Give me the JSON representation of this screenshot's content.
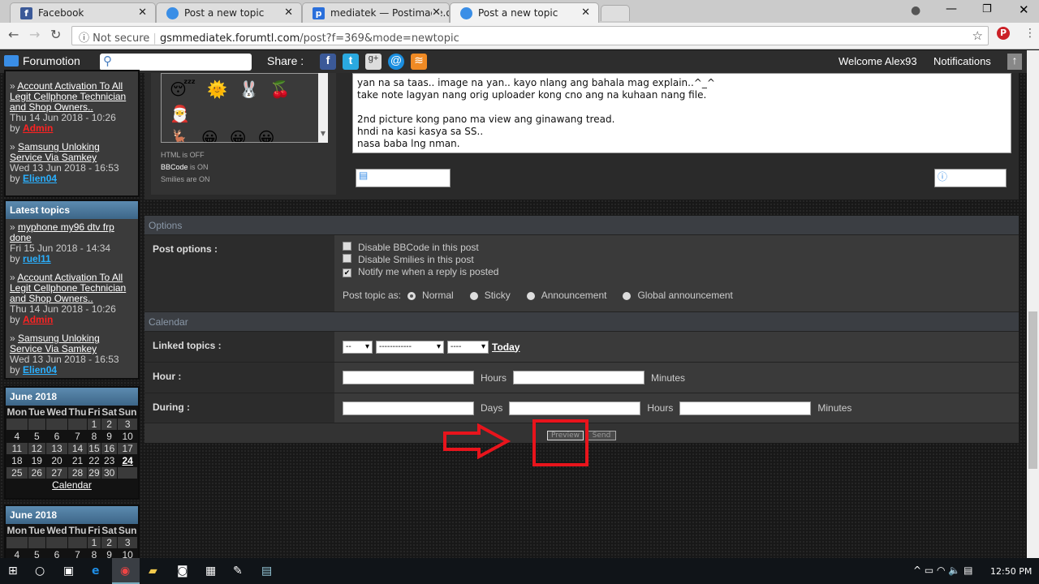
{
  "browser": {
    "tabs": [
      {
        "label": "Facebook",
        "icon": "facebook-icon",
        "color": "#3b5998"
      },
      {
        "label": "Post a new topic",
        "icon": "forumotion-icon",
        "color": "#3a8ee6"
      },
      {
        "label": "mediatek — Postimage.o",
        "icon": "postimage-icon",
        "color": "#2a6fdb"
      },
      {
        "label": "Post a new topic",
        "icon": "forumotion-icon",
        "color": "#3a8ee6"
      }
    ],
    "not_secure": "Not secure",
    "url_host": "gsmmediatek.forumtl.com",
    "url_path": "/post?f=369&mode=newtopic"
  },
  "topbar": {
    "brand": "Forumotion",
    "share_label": "Share :",
    "welcome": "Welcome Alex93",
    "notifications": "Notifications"
  },
  "sidebar": {
    "recent_items": [
      {
        "title": "Account Activation To All Legit Cellphone Technician and Shop Owners..",
        "date": "Thu 14 Jun 2018 - 10:26",
        "by": "by",
        "author": "Admin",
        "author_color": "#ff2222"
      },
      {
        "title": "Samsung Unloking Service Via Samkey",
        "date": "Wed 13 Jun 2018 - 16:53",
        "by": "by",
        "author": "Elien04",
        "author_color": "#2ab0ff"
      }
    ],
    "latest_title": "Latest topics",
    "latest_items": [
      {
        "title": "myphone my96 dtv frp done",
        "date": "Fri 15 Jun 2018 - 14:34",
        "by": "by",
        "author": "ruel11",
        "author_color": "#2ab0ff"
      },
      {
        "title": "Account Activation To All Legit Cellphone Technician and Shop Owners..",
        "date": "Thu 14 Jun 2018 - 10:26",
        "by": "by",
        "author": "Admin",
        "author_color": "#ff2222"
      },
      {
        "title": "Samsung Unloking Service Via Samkey",
        "date": "Wed 13 Jun 2018 - 16:53",
        "by": "by",
        "author": "Elien04",
        "author_color": "#2ab0ff"
      }
    ],
    "calendar": {
      "title": "June 2018",
      "days": [
        "Mon",
        "Tue",
        "Wed",
        "Thu",
        "Fri",
        "Sat",
        "Sun"
      ],
      "weeks": [
        [
          "",
          "",
          "",
          "",
          "1",
          "2",
          "3"
        ],
        [
          "4",
          "5",
          "6",
          "7",
          "8",
          "9",
          "10"
        ],
        [
          "11",
          "12",
          "13",
          "14",
          "15",
          "16",
          "17"
        ],
        [
          "18",
          "19",
          "20",
          "21",
          "22",
          "23",
          "24"
        ],
        [
          "25",
          "26",
          "27",
          "28",
          "29",
          "30",
          ""
        ]
      ],
      "today": "24",
      "link": "Calendar"
    }
  },
  "editor": {
    "status": [
      "HTML is OFF",
      "BBCode",
      "is ON",
      "Smilies are ON"
    ],
    "text_lines": [
      "yan na sa taas.. image na yan.. kayo nlang ang bahala mag explain..^_^",
      "take note lagyan nang orig uploader kong cno ang na kuhaan nang file.",
      "",
      "2nd picture kong pano ma view ang ginawang tread.",
      "hndi na kasi kasya sa SS..",
      "nasa baba lng nman."
    ]
  },
  "options": {
    "header": "Options",
    "label": "Post options :",
    "checkboxes": [
      {
        "label": "Disable BBCode in this post",
        "checked": false
      },
      {
        "label": "Disable Smilies in this post",
        "checked": false
      },
      {
        "label": "Notify me when a reply is posted",
        "checked": true
      }
    ],
    "post_as_label": "Post topic as:",
    "post_as": [
      "Normal",
      "Sticky",
      "Announcement",
      "Global announcement"
    ],
    "post_as_selected": "Normal"
  },
  "calendar_section": {
    "header": "Calendar",
    "linked_label": "Linked topics :",
    "selects": [
      "--",
      "------------",
      "----"
    ],
    "today": "Today",
    "hour_label": "Hour :",
    "hours": "Hours",
    "minutes": "Minutes",
    "during_label": "During :",
    "days": "Days"
  },
  "buttons": {
    "preview": "Preview",
    "send": "Send"
  },
  "annotation_color": "#e8141c",
  "taskbar": {
    "time": "12:50 PM"
  }
}
